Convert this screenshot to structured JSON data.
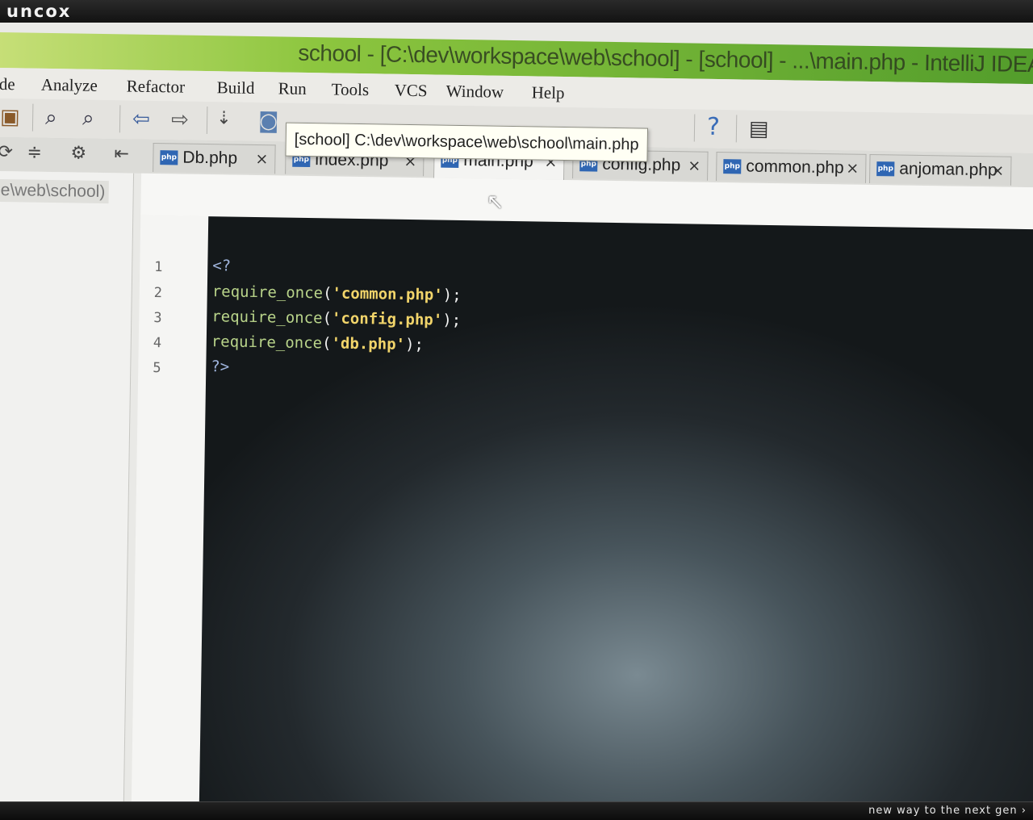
{
  "brand": {
    "logo": "uncox",
    "slogan": "new way to the next gen ›"
  },
  "window": {
    "title": "school - [C:\\dev\\workspace\\web\\school] - [school] - ...\\main.php - IntelliJ IDEA"
  },
  "menu": {
    "items": [
      {
        "label": "de"
      },
      {
        "label": "Analyze"
      },
      {
        "label": "Refactor"
      },
      {
        "label": "Build"
      },
      {
        "label": "Run"
      },
      {
        "label": "Tools"
      },
      {
        "label": "VCS"
      },
      {
        "label": "Window"
      },
      {
        "label": "Help"
      }
    ]
  },
  "toolbar": {
    "icons": [
      "copy-icon",
      "find-icon",
      "replace-icon",
      "back-arrow-icon",
      "forward-arrow-icon",
      "sort-icon",
      "browser-icon",
      "help-icon",
      "save-icon"
    ],
    "help_glyph": "?"
  },
  "tooltip": {
    "text": "[school] C:\\dev\\workspace\\web\\school\\main.php"
  },
  "tabs": [
    {
      "label": "Db.php",
      "active": false
    },
    {
      "label": "index.php",
      "active": false
    },
    {
      "label": "main.php",
      "active": true
    },
    {
      "label": "config.php",
      "active": false
    },
    {
      "label": "common.php",
      "active": false
    },
    {
      "label": "anjoman.php",
      "active": false
    }
  ],
  "tab_icon_text": "php",
  "tab_close_glyph": "×",
  "project": {
    "path": "e\\web\\school)"
  },
  "editor": {
    "lines": [
      {
        "num": "1",
        "parts": [
          {
            "t": "<?",
            "c": "c-tag"
          }
        ]
      },
      {
        "num": "2",
        "parts": [
          {
            "t": "require_once",
            "c": "c-fn"
          },
          {
            "t": "(",
            "c": "c-punc"
          },
          {
            "t": "'common.php'",
            "c": "c-str"
          },
          {
            "t": ");",
            "c": "c-punc"
          }
        ]
      },
      {
        "num": "3",
        "parts": [
          {
            "t": "require_once",
            "c": "c-fn"
          },
          {
            "t": "(",
            "c": "c-punc"
          },
          {
            "t": "'config.php'",
            "c": "c-str"
          },
          {
            "t": ");",
            "c": "c-punc"
          }
        ]
      },
      {
        "num": "4",
        "parts": [
          {
            "t": "require_once",
            "c": "c-fn"
          },
          {
            "t": "(",
            "c": "c-punc"
          },
          {
            "t": "'db.php'",
            "c": "c-str"
          },
          {
            "t": ");",
            "c": "c-punc"
          }
        ]
      },
      {
        "num": "5",
        "parts": [
          {
            "t": "?>",
            "c": "c-tag"
          }
        ]
      }
    ]
  },
  "colors": {
    "title_bar": "#8dc63f",
    "code_background": "#23292d",
    "string": "#f1d46a",
    "function": "#b9d48a"
  }
}
